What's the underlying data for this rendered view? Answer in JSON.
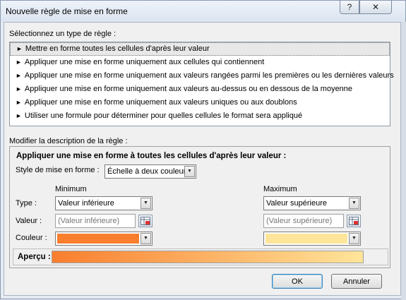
{
  "window": {
    "title": "Nouvelle règle de mise en forme",
    "help": "?",
    "close": "✕"
  },
  "rule_type": {
    "label": "Sélectionnez un type de règle :",
    "items": [
      "Mettre en forme toutes les cellules d'après leur valeur",
      "Appliquer une mise en forme uniquement aux cellules qui contiennent",
      "Appliquer une mise en forme uniquement aux valeurs rangées parmi les premières ou les dernières valeurs",
      "Appliquer une mise en forme uniquement aux valeurs au-dessus ou en dessous de la moyenne",
      "Appliquer une mise en forme uniquement aux valeurs uniques ou aux doublons",
      "Utiliser une formule pour déterminer pour quelles cellules le format sera appliqué"
    ],
    "selected_index": 0
  },
  "description": {
    "label": "Modifier la description de la règle :",
    "heading": "Appliquer une mise en forme à toutes les cellules d'après leur valeur :",
    "style_label": "Style de mise en forme :",
    "style_value": "Échelle à deux couleurs",
    "minimum_header": "Minimum",
    "maximum_header": "Maximum",
    "type_label": "Type :",
    "value_label": "Valeur :",
    "color_label": "Couleur :",
    "min_type": "Valeur inférieure",
    "max_type": "Valeur supérieure",
    "min_value_placeholder": "(Valeur inférieure)",
    "max_value_placeholder": "(Valeur supérieure)",
    "min_color": "#f97e2e",
    "max_color": "#ffe59a",
    "preview_label": "Aperçu :"
  },
  "buttons": {
    "ok": "OK",
    "cancel": "Annuler"
  }
}
